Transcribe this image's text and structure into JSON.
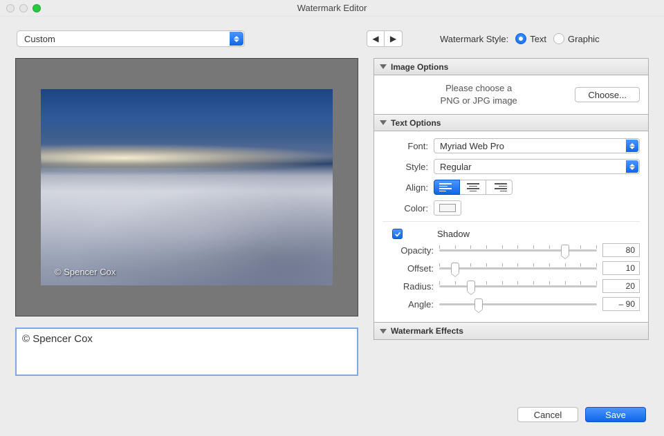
{
  "window": {
    "title": "Watermark Editor"
  },
  "presets": {
    "selected": "Custom"
  },
  "nav": {
    "prev_glyph": "◀",
    "next_glyph": "▶"
  },
  "style": {
    "label": "Watermark Style:",
    "text_label": "Text",
    "graphic_label": "Graphic",
    "selected": "Text"
  },
  "watermark_text": "© Spencer Cox",
  "preview_watermark": "© Spencer Cox",
  "panels": {
    "image_options": {
      "title": "Image Options",
      "message_line1": "Please choose a",
      "message_line2": "PNG or JPG image",
      "choose_btn": "Choose..."
    },
    "text_options": {
      "title": "Text Options",
      "font_label": "Font:",
      "font_value": "Myriad Web Pro",
      "style_label": "Style:",
      "style_value": "Regular",
      "align_label": "Align:",
      "align_value": "left",
      "color_label": "Color:",
      "shadow": {
        "label": "Shadow",
        "checked": true,
        "opacity_label": "Opacity:",
        "opacity": 80,
        "offset_label": "Offset:",
        "offset": 10,
        "radius_label": "Radius:",
        "radius": 20,
        "angle_label": "Angle:",
        "angle": "– 90"
      }
    },
    "watermark_effects": {
      "title": "Watermark Effects"
    }
  },
  "footer": {
    "cancel": "Cancel",
    "save": "Save"
  }
}
